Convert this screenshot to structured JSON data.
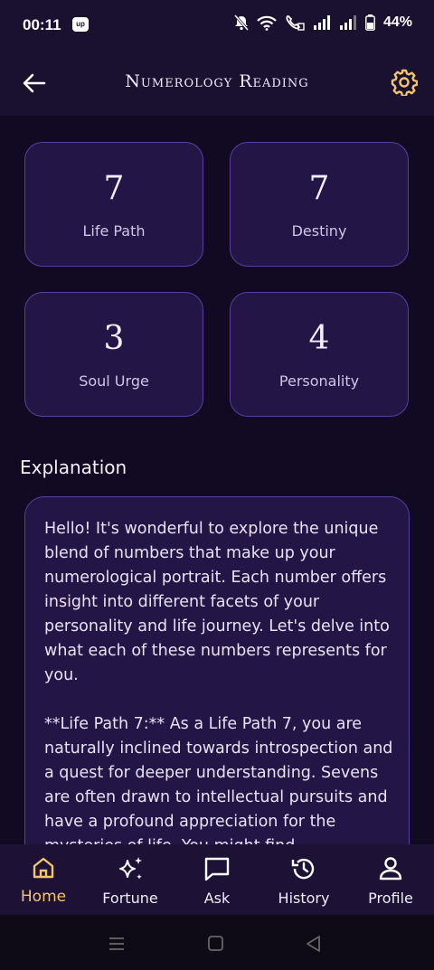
{
  "status": {
    "time": "00:11",
    "app_badge": "up",
    "battery": "44%"
  },
  "header": {
    "title": "Numerology Reading"
  },
  "numbers": [
    {
      "value": "7",
      "label": "Life Path"
    },
    {
      "value": "7",
      "label": "Destiny"
    },
    {
      "value": "3",
      "label": "Soul Urge"
    },
    {
      "value": "4",
      "label": "Personality"
    }
  ],
  "explanation": {
    "heading": "Explanation",
    "paragraph1": "Hello! It's wonderful to explore the unique blend of numbers that make up your numerological portrait. Each number offers insight into different facets of your personality and life journey. Let's delve into what each of these numbers represents for you.",
    "paragraph2": "**Life Path 7:** As a Life Path 7, you are naturally inclined towards introspection and a quest for deeper understanding. Sevens are often drawn to intellectual pursuits and have a profound appreciation for the mysteries of life. You might find"
  },
  "nav": {
    "items": [
      {
        "label": "Home",
        "icon": "home-icon",
        "active": true
      },
      {
        "label": "Fortune",
        "icon": "sparkles-icon",
        "active": false
      },
      {
        "label": "Ask",
        "icon": "chat-icon",
        "active": false
      },
      {
        "label": "History",
        "icon": "history-icon",
        "active": false
      },
      {
        "label": "Profile",
        "icon": "person-icon",
        "active": false
      }
    ]
  },
  "colors": {
    "background": "#110a22",
    "card": "#231546",
    "card_border": "#5a3fa2",
    "accent": "#f2c56b"
  }
}
